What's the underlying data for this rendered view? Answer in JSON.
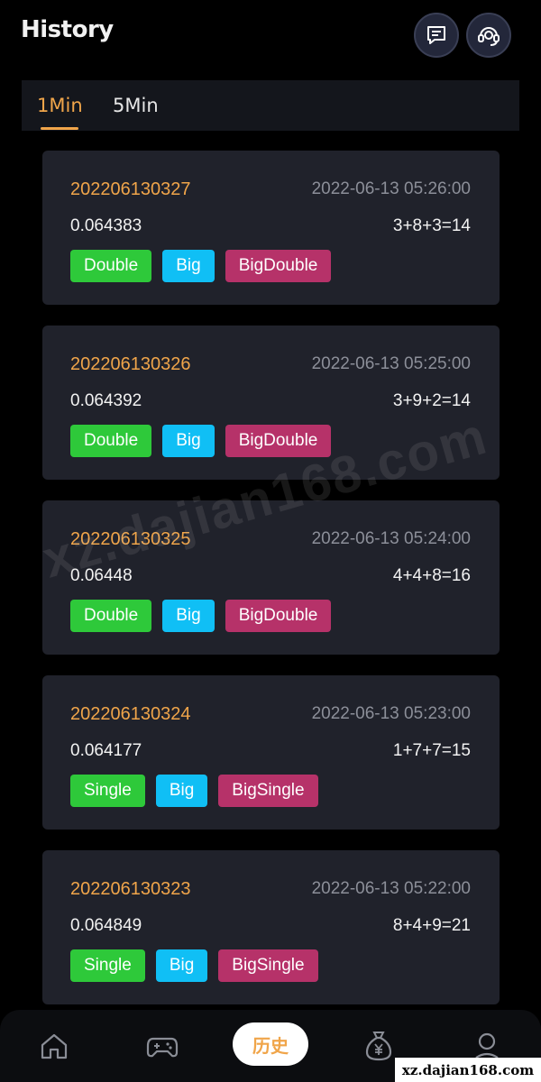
{
  "header": {
    "title": "History"
  },
  "tabs": [
    {
      "label": "1Min",
      "active": true
    },
    {
      "label": "5Min",
      "active": false
    }
  ],
  "colors": {
    "accent": "#f0a54a",
    "tag_double": "#2ec93a",
    "tag_single": "#2ec93a",
    "tag_big": "#10bff5",
    "tag_combo": "#b63269"
  },
  "records": [
    {
      "period": "202206130327",
      "time": "2022-06-13 05:26:00",
      "price": "0.064383",
      "sum": "3+8+3=14",
      "tags": [
        "Double",
        "Big",
        "BigDouble"
      ]
    },
    {
      "period": "202206130326",
      "time": "2022-06-13 05:25:00",
      "price": "0.064392",
      "sum": "3+9+2=14",
      "tags": [
        "Double",
        "Big",
        "BigDouble"
      ]
    },
    {
      "period": "202206130325",
      "time": "2022-06-13 05:24:00",
      "price": "0.06448",
      "sum": "4+4+8=16",
      "tags": [
        "Double",
        "Big",
        "BigDouble"
      ]
    },
    {
      "period": "202206130324",
      "time": "2022-06-13 05:23:00",
      "price": "0.064177",
      "sum": "1+7+7=15",
      "tags": [
        "Single",
        "Big",
        "BigSingle"
      ]
    },
    {
      "period": "202206130323",
      "time": "2022-06-13 05:22:00",
      "price": "0.064849",
      "sum": "8+4+9=21",
      "tags": [
        "Single",
        "Big",
        "BigSingle"
      ]
    }
  ],
  "nav": {
    "items": [
      "home-icon",
      "gamepad-icon",
      "history",
      "money-bag-icon",
      "profile-icon"
    ],
    "center_label": "历史"
  },
  "watermark": {
    "text": "xz.dajian168.com",
    "corner_text": "xz.dajian168.com"
  }
}
